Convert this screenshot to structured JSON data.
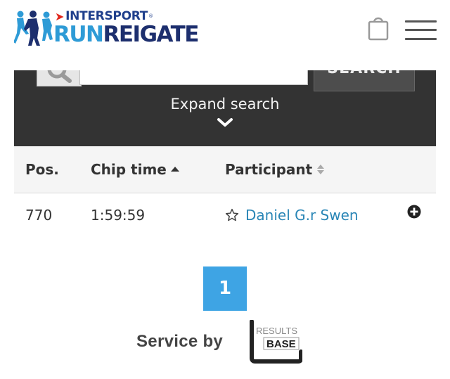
{
  "header": {
    "brand": "INTERSPORT",
    "brand_mark": "®",
    "event_part1": "RUN",
    "event_part2": "REIGATE"
  },
  "search": {
    "button_label": "SEARCH",
    "expand_label": "Expand search"
  },
  "table": {
    "columns": [
      {
        "label": "Pos.",
        "sort": "none"
      },
      {
        "label": "Chip time",
        "sort": "ascending"
      },
      {
        "label": "Participant",
        "sort": "sortable"
      }
    ],
    "rows": [
      {
        "position": "770",
        "chip_time": "1:59:59",
        "participant": "Daniel G.r Swen"
      }
    ]
  },
  "pagination": {
    "current_page": "1"
  },
  "footer": {
    "service_by": "Service by",
    "logo_line1": "RESULTS",
    "logo_line2": "BASE"
  },
  "colors": {
    "panel": "#333333",
    "accent_blue": "#3ea4e4",
    "link": "#2a86b6",
    "brand_navy": "#1d2f6e",
    "brand_light": "#2e9bd6",
    "brand_red": "#e1261c"
  },
  "icons": [
    "runners-logo-icon",
    "shopping-bag-icon",
    "hamburger-menu-icon",
    "search-icon",
    "chevron-down-icon",
    "sort-ascending-icon",
    "sort-both-icon",
    "star-outline-icon",
    "plus-circle-icon",
    "results-base-logo"
  ]
}
